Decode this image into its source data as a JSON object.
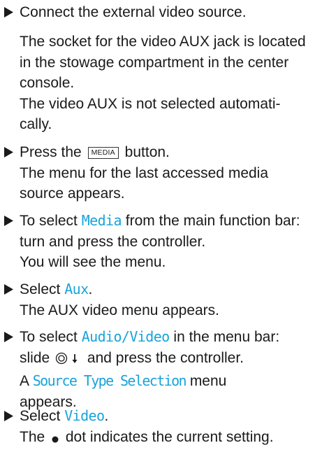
{
  "steps": [
    {
      "lines": [
        "Connect the external video source."
      ]
    },
    {
      "lines": [
        "The socket for the video AUX jack is located",
        "in the stowage compartment in the center",
        "console.",
        "The video AUX is not selected automati-",
        "cally."
      ]
    },
    {
      "pre": "Press the",
      "key": "MEDIA",
      "post": "button.",
      "lines": [
        "The menu for the last accessed media",
        "source appears."
      ]
    },
    {
      "pre": "To select",
      "menu": "Media",
      "post": "from the main function bar:",
      "lines": [
        "turn and press the controller.",
        "You will see the menu."
      ]
    },
    {
      "pre": "Select",
      "menu": "Aux",
      "post": ".",
      "lines": [
        "The AUX video menu appears."
      ]
    },
    {
      "pre": "To select",
      "menu": "Audio/Video",
      "post": "in the menu bar:",
      "line2_pre": "slide",
      "line2_post": "and press the controller.",
      "line3_pre": "A",
      "line3_menu": "Source Type Selection",
      "line3_post": "menu",
      "lines": [
        "appears."
      ]
    },
    {
      "pre": "Select",
      "menu": "Video",
      "post": ".",
      "line2_pre": "The",
      "line2_post": "dot indicates the current setting."
    }
  ],
  "icons": {
    "bullet": "right-triangle-bullet",
    "controller_slide": "controller-slide-down-icon",
    "dot": "radio-dot-icon"
  },
  "colors": {
    "text": "#1a1a1a",
    "menu_highlight": "#1aa3d9"
  }
}
